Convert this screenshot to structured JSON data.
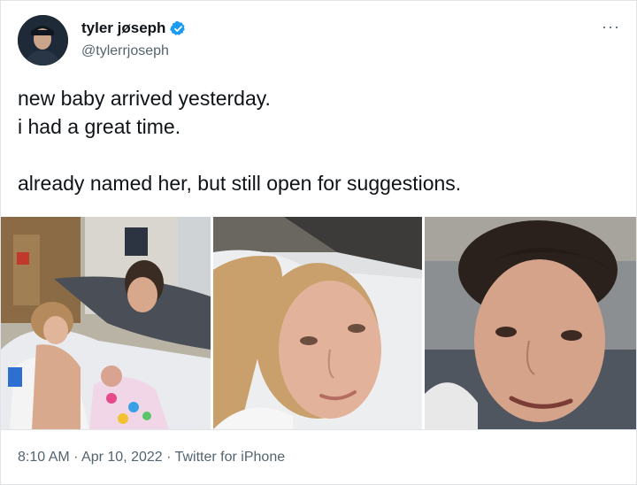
{
  "author": {
    "display_name": "tyler jøseph",
    "handle": "@tylerrjoseph",
    "verified": true
  },
  "tweet": {
    "line1": "new baby arrived yesterday.",
    "line2": "i had a great time.",
    "line3": "already named her, but still open for suggestions."
  },
  "media": {
    "count": 3
  },
  "meta": {
    "time": "8:10 AM",
    "separator": " · ",
    "date": "Apr 10, 2022",
    "source": "Twitter for iPhone"
  },
  "more_icon": "···",
  "colors": {
    "verified_blue": "#1d9bf0",
    "secondary_text": "#536471",
    "primary_text": "#0f1419"
  }
}
